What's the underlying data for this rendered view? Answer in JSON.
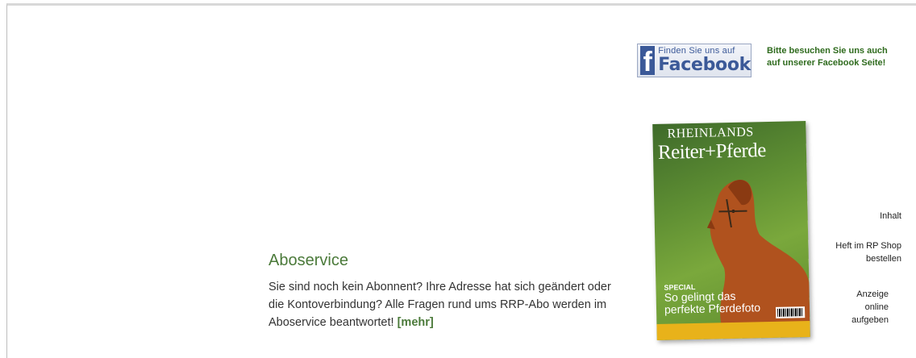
{
  "facebook": {
    "badge_small": "Finden Sie uns auf",
    "badge_big": "Facebook",
    "logo_letter": "f",
    "note_line1": "Bitte besuchen Sie uns auch",
    "note_line2": "auf unserer Facebook Seite!"
  },
  "aboservice": {
    "title": "Aboservice",
    "text": "Sie sind noch kein Abonnent? Ihre Adresse hat sich geändert oder die Kontoverbindung? Alle Fragen rund ums RRP-Abo werden im Aboservice beantwortet! ",
    "more_label": "[mehr]"
  },
  "cover": {
    "masthead_top": "RHEINLANDS",
    "masthead_main": "Reiter+Pferde",
    "special_tag": "SPECIAL",
    "special_line1": "So gelingt das",
    "special_line2": "perfekte Pferdefoto"
  },
  "side_links": {
    "inhalt": "Inhalt",
    "shop_line1": "Heft im RP Shop",
    "shop_line2": "bestellen",
    "anzeige_line1": "Anzeige",
    "anzeige_line2": "online",
    "anzeige_line3": "aufgeben"
  },
  "colors": {
    "accent_green": "#4b7a3a",
    "facebook_blue": "#3b5998"
  }
}
